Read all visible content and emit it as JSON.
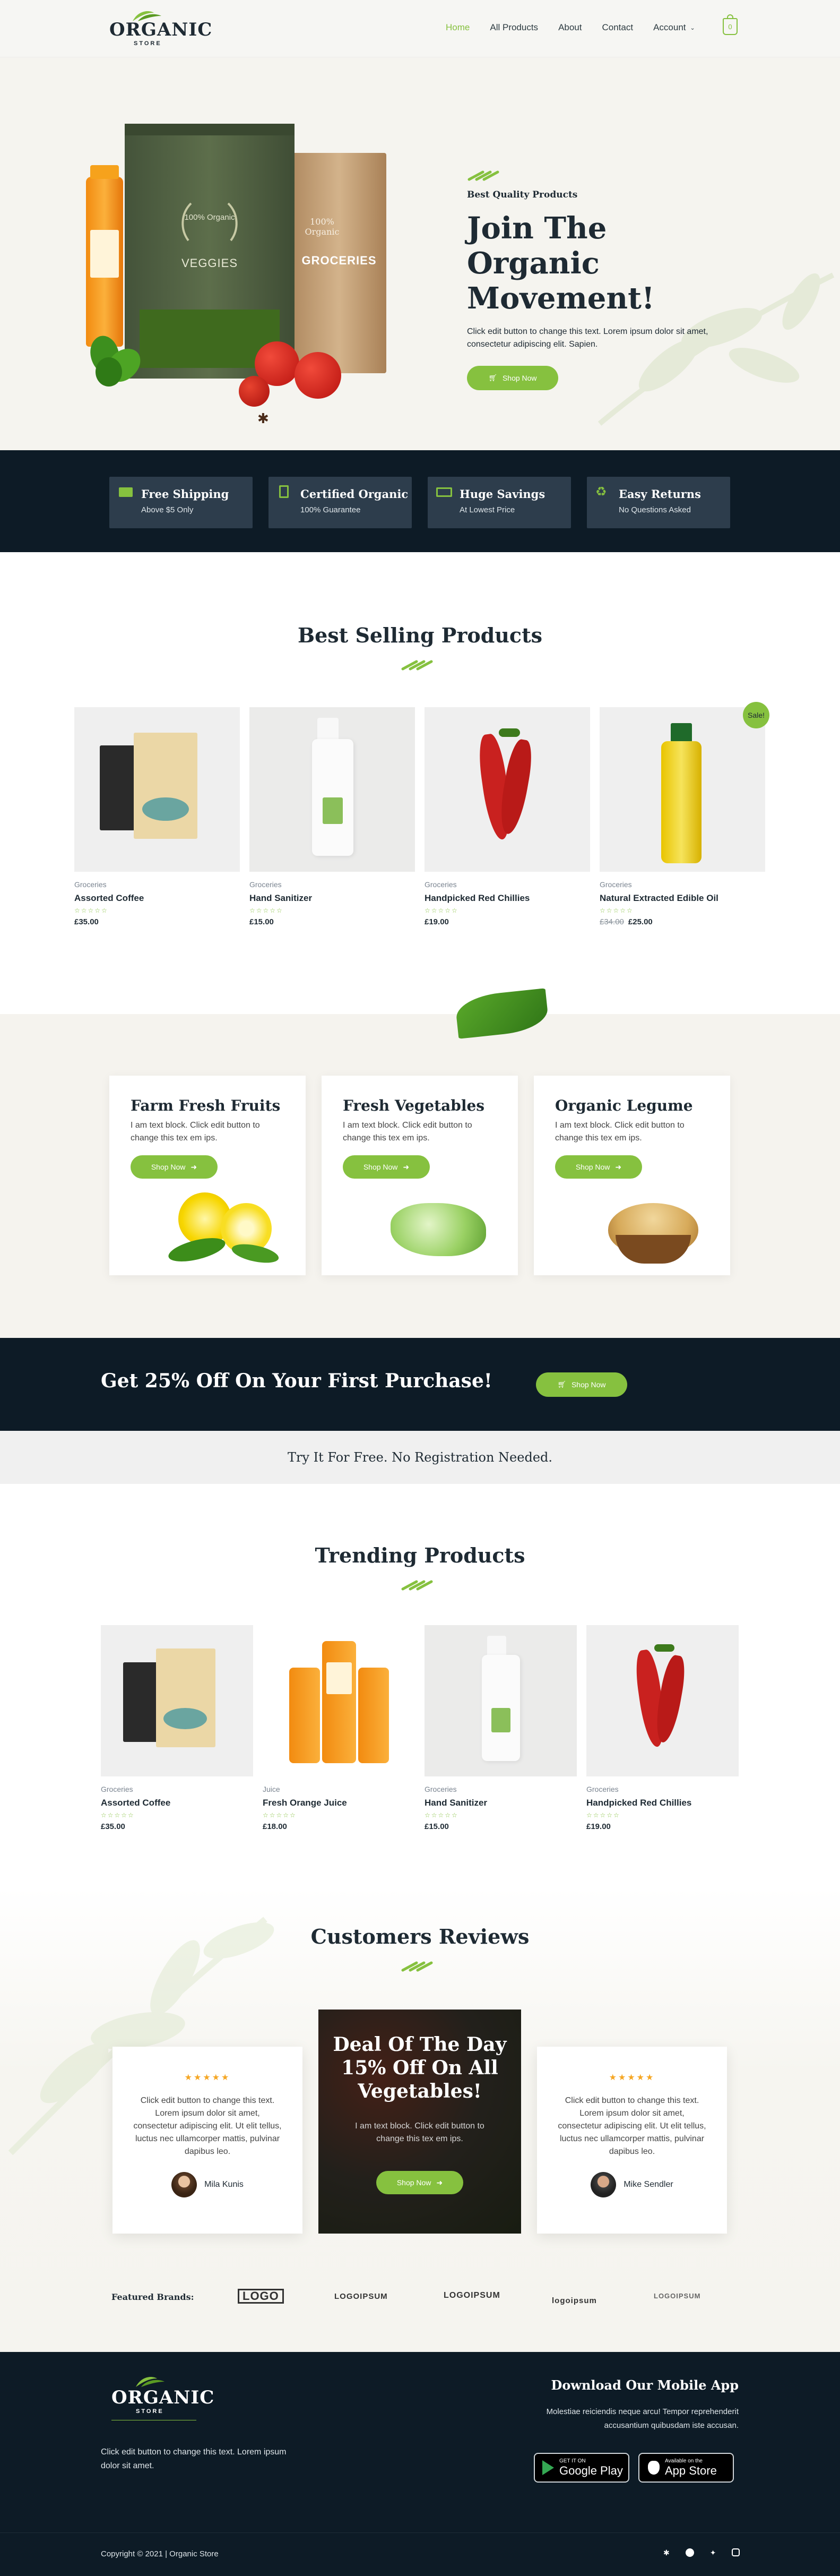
{
  "nav": {
    "logo_main": "ORGANIC",
    "logo_sub": "STORE",
    "links": [
      "Home",
      "All Products",
      "About",
      "Contact",
      "Account"
    ],
    "cart_count": "0"
  },
  "hero": {
    "subtitle": "Best Quality Products",
    "title_line1": "Join The Organic",
    "title_line2": "Movement!",
    "desc": "Click edit button to change this text. Lorem ipsum dolor sit amet, consectetur adipiscing elit. Sapien.",
    "button": "Shop Now",
    "bag1_label": "VEGGIES",
    "bag1_badge": "100% Organic",
    "bag2_label": "GROCERIES",
    "bag2_badge": "100% Organic"
  },
  "features": [
    {
      "icon": "truck-icon",
      "title": "Free Shipping",
      "sub": "Above $5 Only"
    },
    {
      "icon": "certificate-icon",
      "title": "Certified Organic",
      "sub": "100% Guarantee"
    },
    {
      "icon": "money-icon",
      "title": "Huge Savings",
      "sub": "At Lowest Price"
    },
    {
      "icon": "recycle-icon",
      "title": "Easy Returns",
      "sub": "No Questions Asked"
    }
  ],
  "best_selling": {
    "title": "Best Selling Products",
    "sale_badge": "Sale!",
    "products": [
      {
        "cat": "Groceries",
        "name": "Assorted Coffee",
        "price": "£35.00",
        "old_price": ""
      },
      {
        "cat": "Groceries",
        "name": "Hand Sanitizer",
        "price": "£15.00",
        "old_price": ""
      },
      {
        "cat": "Groceries",
        "name": "Handpicked Red Chillies",
        "price": "£19.00",
        "old_price": ""
      },
      {
        "cat": "Groceries",
        "name": "Natural Extracted Edible Oil",
        "price": "£25.00",
        "old_price": "£34.00"
      }
    ]
  },
  "categories": [
    {
      "title": "Farm Fresh Fruits",
      "desc": "I am text block. Click edit button to change this tex em ips.",
      "button": "Shop Now"
    },
    {
      "title": "Fresh Vegetables",
      "desc": "I am text block. Click edit button to change this tex em ips.",
      "button": "Shop Now"
    },
    {
      "title": "Organic Legume",
      "desc": "I am text block. Click edit button to change this tex em ips.",
      "button": "Shop Now"
    }
  ],
  "promo": {
    "title": "Get 25% Off On Your First Purchase!",
    "button": "Shop Now",
    "strip": "Try It For Free. No Registration Needed."
  },
  "trending": {
    "title": "Trending Products",
    "products": [
      {
        "cat": "Groceries",
        "name": "Assorted Coffee",
        "price": "£35.00"
      },
      {
        "cat": "Juice",
        "name": "Fresh Orange Juice",
        "price": "£18.00"
      },
      {
        "cat": "Groceries",
        "name": "Hand Sanitizer",
        "price": "£15.00"
      },
      {
        "cat": "Groceries",
        "name": "Handpicked Red Chillies",
        "price": "£19.00"
      }
    ]
  },
  "reviews": {
    "title": "Customers Reviews",
    "items": [
      {
        "text": "Click edit button to change this text. Lorem ipsum dolor sit amet, consectetur adipiscing elit. Ut elit tellus, luctus nec ullamcorper mattis, pulvinar dapibus leo.",
        "name": "Mila Kunis",
        "stars": "★★★★★"
      },
      {
        "text": "Click edit button to change this text. Lorem ipsum dolor sit amet, consectetur adipiscing elit. Ut elit tellus, luctus nec ullamcorper mattis, pulvinar dapibus leo.",
        "name": "Mike Sendler",
        "stars": "★★★★★"
      }
    ],
    "deal_line1": "Deal Of The Day",
    "deal_line2": "15% Off On All",
    "deal_line3": "Vegetables!",
    "deal_desc": "I am text block. Click edit button to change this tex em ips.",
    "deal_button": "Shop Now"
  },
  "brands": {
    "label": "Featured Brands:",
    "items": [
      "LOGO",
      "LOGOIPSUM",
      "LOGOIPSUM",
      "logoipsum",
      "LOGOIPSUM"
    ]
  },
  "footer": {
    "logo_main": "ORGANIC",
    "logo_sub": "STORE",
    "desc": "Click edit button to change this text. Lorem ipsum dolor sit amet.",
    "app_title": "Download Our Mobile App",
    "app_desc": "Molestiae reiciendis neque arcu! Tempor reprehenderit accusantium quibusdam iste accusan.",
    "google_small": "GET IT ON",
    "google_big": "Google Play",
    "apple_small": "Available on the",
    "apple_big": "App Store",
    "copyright": "Copyright © 2021 | Organic Store"
  },
  "colors": {
    "accent": "#86c13f",
    "dark": "#0d1b26",
    "light_bg": "#f5f3ee"
  }
}
